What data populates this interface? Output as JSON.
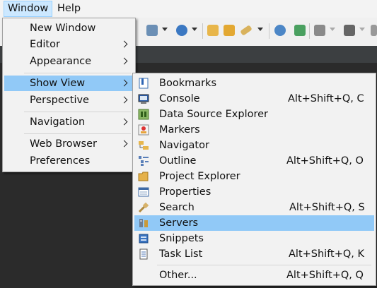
{
  "menubar": {
    "window_label": "Window",
    "help_label": "Help"
  },
  "window_menu": {
    "items": [
      "New Window",
      "Editor",
      "Appearance",
      "Show View",
      "Perspective",
      "Navigation",
      "Web Browser",
      "Preferences"
    ]
  },
  "show_view_menu": {
    "items": [
      {
        "label": "Bookmarks",
        "shortcut": "",
        "icon": "bookmarks-icon"
      },
      {
        "label": "Console",
        "shortcut": "Alt+Shift+Q, C",
        "icon": "console-icon"
      },
      {
        "label": "Data Source Explorer",
        "shortcut": "",
        "icon": "data-source-explorer-icon"
      },
      {
        "label": "Markers",
        "shortcut": "",
        "icon": "markers-icon"
      },
      {
        "label": "Navigator",
        "shortcut": "",
        "icon": "navigator-icon"
      },
      {
        "label": "Outline",
        "shortcut": "Alt+Shift+Q, O",
        "icon": "outline-icon"
      },
      {
        "label": "Project Explorer",
        "shortcut": "",
        "icon": "project-explorer-icon"
      },
      {
        "label": "Properties",
        "shortcut": "",
        "icon": "properties-icon"
      },
      {
        "label": "Search",
        "shortcut": "Alt+Shift+Q, S",
        "icon": "search-icon"
      },
      {
        "label": "Servers",
        "shortcut": "",
        "icon": "servers-icon"
      },
      {
        "label": "Snippets",
        "shortcut": "",
        "icon": "snippets-icon"
      },
      {
        "label": "Task List",
        "shortcut": "Alt+Shift+Q, K",
        "icon": "task-list-icon"
      },
      {
        "label": "Other...",
        "shortcut": "Alt+Shift+Q, Q",
        "icon": ""
      }
    ]
  },
  "colors": {
    "selection": "#91c9f7",
    "menu_bg": "#f2f2f2",
    "editor_bg": "#2b2b2b"
  }
}
